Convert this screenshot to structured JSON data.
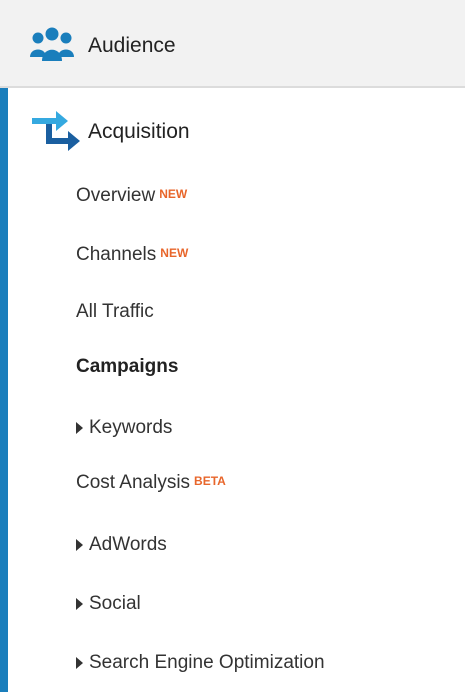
{
  "colors": {
    "accent_blue": "#1a7ebc",
    "badge_orange": "#e8662b"
  },
  "nav": {
    "audience": {
      "label": "Audience",
      "icon": "audience-people-icon"
    },
    "acquisition": {
      "label": "Acquisition",
      "icon": "acquisition-arrows-icon",
      "items": [
        {
          "label": "Overview",
          "badge": "NEW"
        },
        {
          "label": "Channels",
          "badge": "NEW"
        },
        {
          "label": "All Traffic"
        },
        {
          "label": "Campaigns",
          "selected": true
        },
        {
          "label": "Keywords",
          "expandable": true
        },
        {
          "label": "Cost Analysis",
          "badge": "BETA"
        },
        {
          "label": "AdWords",
          "expandable": true
        },
        {
          "label": "Social",
          "expandable": true
        },
        {
          "label": "Search Engine Optimization",
          "expandable": true
        }
      ]
    }
  }
}
